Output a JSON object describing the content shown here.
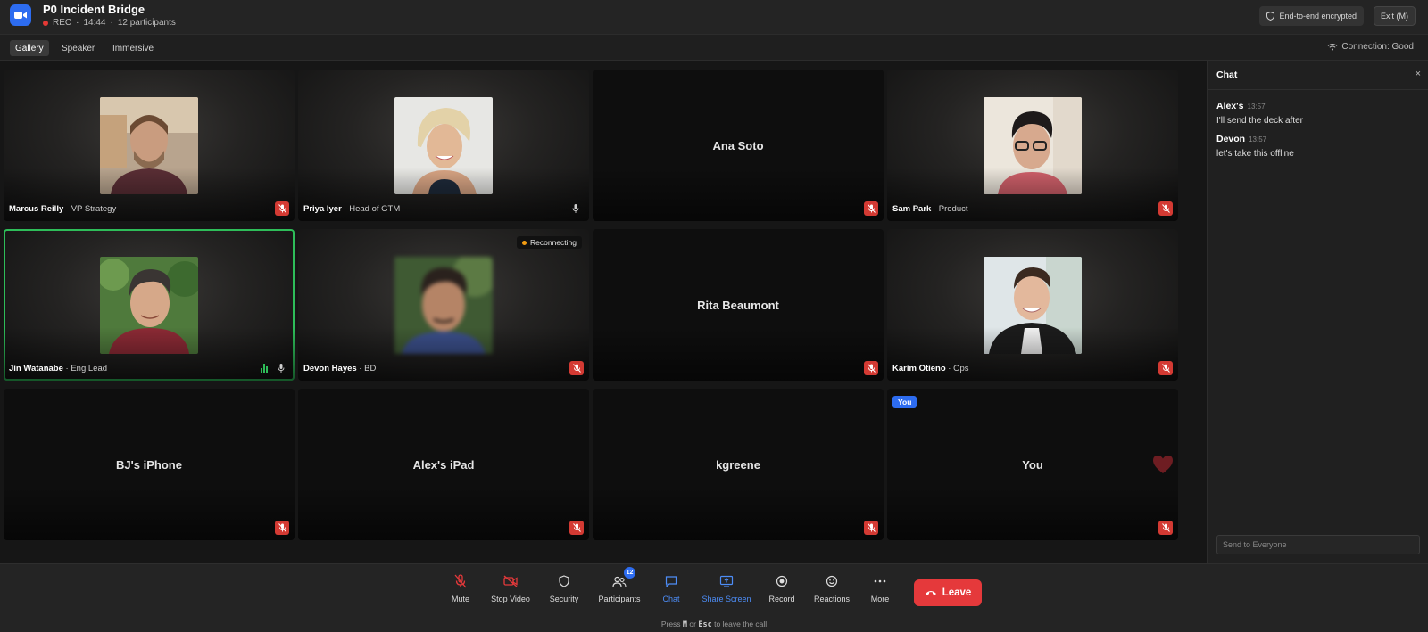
{
  "header": {
    "title": "P0 Incident Bridge",
    "rec_label": "REC",
    "timer": "14:44",
    "participants_label": "12 participants",
    "encryption_label": "End-to-end encrypted",
    "exit_label": "Exit (M)"
  },
  "views": {
    "gallery": "Gallery",
    "speaker": "Speaker",
    "immersive": "Immersive",
    "active": "Gallery",
    "connection": "Connection: Good"
  },
  "tiles": [
    {
      "name": "Marcus Reilly",
      "role": " · VP Strategy",
      "video": true,
      "muted": true
    },
    {
      "name": "Priya Iyer",
      "role": " · Head of GTM",
      "video": true,
      "muted": false
    },
    {
      "name": "Ana Soto",
      "role": "",
      "video": false,
      "muted": true
    },
    {
      "name": "Sam Park",
      "role": " · Product",
      "video": true,
      "muted": true
    },
    {
      "name": "Jin Watanabe",
      "role": " · Eng Lead",
      "video": true,
      "muted": false,
      "speaking": true
    },
    {
      "name": "Devon Hayes",
      "role": " · BD",
      "video": true,
      "muted": true,
      "status": "Reconnecting"
    },
    {
      "name": "Rita Beaumont",
      "role": "",
      "video": false,
      "muted": true
    },
    {
      "name": "Karim Otieno",
      "role": " · Ops",
      "video": true,
      "muted": true
    },
    {
      "name": "BJ's iPhone",
      "role": "",
      "video": false,
      "muted": true
    },
    {
      "name": "Alex's iPad",
      "role": "",
      "video": false,
      "muted": true
    },
    {
      "name": "kgreene",
      "role": "",
      "video": false,
      "muted": true
    },
    {
      "name": "You",
      "role": "",
      "video": false,
      "muted": true,
      "badge": "You"
    }
  ],
  "chat": {
    "title": "Chat",
    "close": "×",
    "messages": [
      {
        "author": "Alex's",
        "time": "13:57",
        "text": "I'll send the deck after"
      },
      {
        "author": "Devon",
        "time": "13:57",
        "text": "let's take this offline"
      }
    ],
    "input_placeholder": "Send to Everyone"
  },
  "toolbar": {
    "mute": "Mute",
    "stop_video": "Stop Video",
    "security": "Security",
    "participants": "Participants",
    "participants_count": "12",
    "chat": "Chat",
    "share_screen": "Share Screen",
    "record": "Record",
    "reactions": "Reactions",
    "more": "More",
    "leave": "Leave",
    "hint_press": "Press",
    "hint_key1": "M",
    "hint_or": "or",
    "hint_key2": "Esc",
    "hint_tail": "to leave the call"
  },
  "colors": {
    "accent": "#2d6cf0",
    "danger": "#e5393b",
    "speaking": "#2ebd59",
    "reconnecting": "#f39c12"
  }
}
